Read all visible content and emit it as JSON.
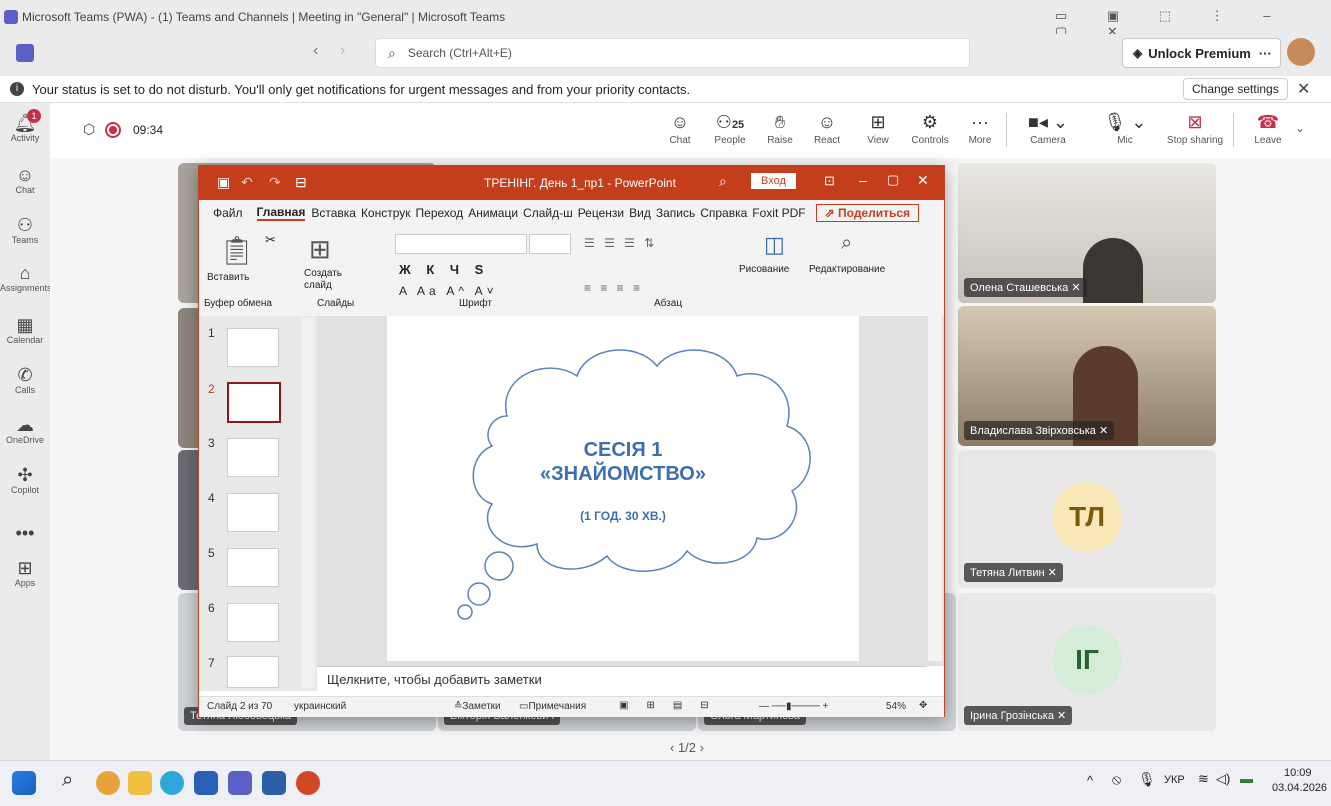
{
  "window": {
    "title": "Microsoft Teams (PWA) - (1) Teams and Channels | Meeting in \"General\" | Microsoft Teams"
  },
  "search": {
    "placeholder": "Search (Ctrl+Alt+E)"
  },
  "premium": {
    "label": "Unlock Premium",
    "more": "···"
  },
  "notification": {
    "text": "Your status is set to do not disturb. You'll only get notifications for urgent messages and from your priority contacts.",
    "button": "Change settings"
  },
  "rail": [
    {
      "label": "Activity",
      "icon": "bell-icon",
      "badge": "1"
    },
    {
      "label": "Chat",
      "icon": "chat-icon"
    },
    {
      "label": "Teams",
      "icon": "teams-icon"
    },
    {
      "label": "Assignments",
      "icon": "assignments-icon"
    },
    {
      "label": "Calendar",
      "icon": "calendar-icon"
    },
    {
      "label": "Calls",
      "icon": "phone-icon"
    },
    {
      "label": "OneDrive",
      "icon": "cloud-icon"
    },
    {
      "label": "Copilot",
      "icon": "copilot-icon"
    },
    {
      "label": "",
      "icon": "more-icon"
    },
    {
      "label": "Apps",
      "icon": "add-icon"
    }
  ],
  "meeting": {
    "timer": "09:34",
    "people_count": "25",
    "buttons": [
      "Chat",
      "People",
      "Raise",
      "React",
      "View",
      "Controls",
      "More",
      "Camera",
      "Mic",
      "Stop sharing",
      "Leave"
    ]
  },
  "participants": [
    {
      "name": "Олена Сташевська",
      "muted": true
    },
    {
      "name": "Владислава Звірховська",
      "muted": true
    },
    {
      "name": "Тетяна Литвин",
      "initials": "ТЛ",
      "muted": true
    },
    {
      "name": "Ірина Грозінська",
      "initials": "ІГ",
      "muted": true
    }
  ],
  "hidden_names": [
    "Тетяна Любовецька",
    "Вікторія Валенкевич",
    "Ольга Мартинова"
  ],
  "pagination": "1/2",
  "ppt": {
    "title": "ТРЕНІНГ. День 1_пр1  -  PowerPoint",
    "login": "Вход",
    "share": "Поделиться",
    "menu": [
      "Файл",
      "Главная",
      "Вставка",
      "Конструк",
      "Переход",
      "Анимаци",
      "Слайд-ш",
      "Рецензи",
      "Вид",
      "Запись",
      "Справка",
      "Foxit PDF"
    ],
    "groups": [
      "Буфер обмена",
      "Слайды",
      "Шрифт",
      "Абзац",
      "Рисование",
      "Редактирование"
    ],
    "buttons": {
      "paste": "Вставить",
      "new_slide": "Создать слайд",
      "draw": "Рисование",
      "edit": "Редактирование"
    },
    "slide": {
      "line1": "СЕСІЯ 1",
      "line2": "«ЗНАЙОМСТВО»",
      "line3": "(1 ГОД. 30 ХВ.)"
    },
    "notes_placeholder": "Щелкните, чтобы добавить заметки",
    "status": {
      "slide": "Слайд 2 из 70",
      "lang": "украинский",
      "notes": "Заметки",
      "comments": "Примечания",
      "zoom": "54%"
    },
    "thumb_numbers": [
      "1",
      "2",
      "3",
      "4",
      "5",
      "6",
      "7"
    ]
  },
  "taskbar": {
    "lang": "УКР",
    "time": "10:09",
    "date": "03.04.2026"
  }
}
